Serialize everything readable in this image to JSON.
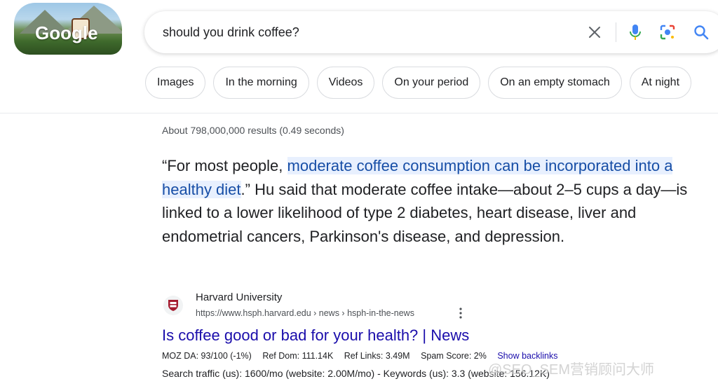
{
  "doodle": {
    "logo_text": "Google",
    "label": "Google Doodle",
    "colors": {
      "sky": "#9ec7e6",
      "hills": "#3f6a2c"
    }
  },
  "search": {
    "query": "should you drink coffee?",
    "placeholder": "",
    "icons": [
      "close-icon",
      "mic-icon",
      "lens-icon",
      "search-icon"
    ]
  },
  "chips": [
    "Images",
    "In the morning",
    "Videos",
    "On your period",
    "On an empty stomach",
    "At night"
  ],
  "results_stats": "About 798,000,000 results (0.49 seconds)",
  "featured_snippet": {
    "prefix": "“For most people, ",
    "highlight": "moderate coffee consumption can be incorporated into a healthy diet",
    "suffix": ".” Hu said that moderate coffee intake—about 2–5 cups a day—is linked to a lower likelihood of type 2 diabetes, heart disease, liver and endometrial cancers, Parkinson's disease, and depression."
  },
  "result": {
    "source_name": "Harvard University",
    "url": "https://www.hsph.harvard.edu › news › hsph-in-the-news",
    "title": "Is coffee good or bad for your health? | News",
    "seo_metrics": {
      "moz_da": "MOZ DA: 93/100 (-1%)",
      "ref_dom": "Ref Dom: 111.14K",
      "ref_links": "Ref Links: 3.49M",
      "spam_score": "Spam Score: 2%",
      "backlinks_link": "Show backlinks"
    },
    "traffic": "Search traffic (us): 1600/mo (website: 2.00M/mo) - Keywords (us): 3.3 (website: 156.12K)"
  },
  "watermark": "@SEO_SEM营销顾问大师",
  "colors": {
    "link": "#1a0dab",
    "highlight_bg": "#e8f0fe",
    "highlight_text": "#174ea6",
    "mic_blue": "#4285f4"
  }
}
